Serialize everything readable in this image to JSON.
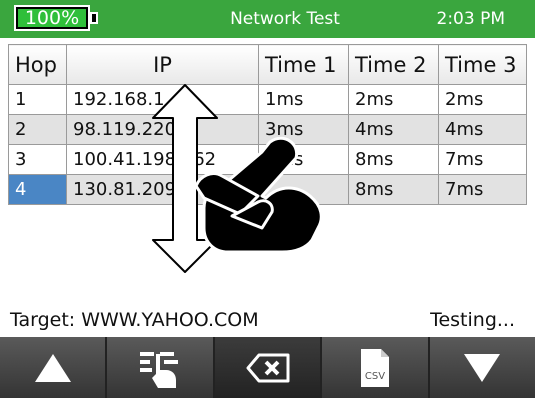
{
  "status_bar": {
    "battery": "100%",
    "battery_level": 1.0,
    "title": "Network Test",
    "time": "2:03 PM"
  },
  "table": {
    "headers": [
      "Hop",
      "IP",
      "Time 1",
      "Time 2",
      "Time 3"
    ],
    "rows": [
      [
        "1",
        "192.168.1",
        "1ms",
        "2ms",
        "2ms"
      ],
      [
        "2",
        "98.119.220.1",
        "3ms",
        "4ms",
        "4ms"
      ],
      [
        "3",
        "100.41.198.162",
        "7ms",
        "8ms",
        "7ms"
      ],
      [
        "4",
        "130.81.209",
        "",
        "8ms",
        "7ms"
      ]
    ],
    "selected_row": 4
  },
  "footer": {
    "target": "Target: WWW.YAHOO.COM",
    "status": "Testing..."
  },
  "toolbar": {
    "csv_label": "CSV",
    "icons": [
      "triangle-up-icon",
      "hand-menu-icon",
      "backspace-icon",
      "csv-file-icon",
      "triangle-down-icon"
    ]
  },
  "overlay": {
    "icons": [
      "vertical-scroll-arrow-icon",
      "pointing-hand-icon"
    ]
  },
  "colors": {
    "status_green": "#3aa63e",
    "selected_blue": "#4a86c5",
    "toolbar_gray": "#4a4a4a"
  }
}
